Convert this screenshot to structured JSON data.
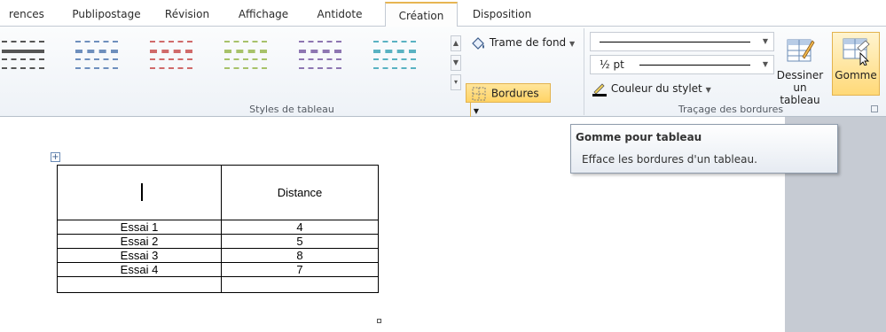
{
  "tabs": [
    {
      "label": "rences"
    },
    {
      "label": "Publipostage"
    },
    {
      "label": "Révision"
    },
    {
      "label": "Affichage"
    },
    {
      "label": "Antidote"
    },
    {
      "label": "Création"
    },
    {
      "label": "Disposition"
    }
  ],
  "active_tab": "Création",
  "groups": {
    "styles": "Styles de tableau",
    "tracage": "Traçage des bordures"
  },
  "commands": {
    "trame_de_fond": "Trame de fond",
    "bordures": "Bordures",
    "pen_weight": "½ pt",
    "couleur_stylet": "Couleur du stylet",
    "dessiner_line1": "Dessiner",
    "dessiner_line2": "un tableau",
    "gomme": "Gomme"
  },
  "swatch_colors": [
    "#5a5a5a",
    "#6e8fbd",
    "#d06a6a",
    "#a7c26a",
    "#8e76b2",
    "#59b2c2"
  ],
  "tooltip": {
    "title": "Gomme pour tableau",
    "description": "Efface les bordures d'un tableau."
  },
  "table": {
    "header": [
      "",
      "Distance"
    ],
    "rows": [
      [
        "Essai 1",
        "4"
      ],
      [
        "Essai 2",
        "5"
      ],
      [
        "Essai 3",
        "8"
      ],
      [
        "Essai 4",
        "7"
      ],
      [
        "",
        ""
      ]
    ]
  },
  "colors": {
    "active_tab_accent": "#e7b552",
    "highlight": "#ffd365"
  }
}
